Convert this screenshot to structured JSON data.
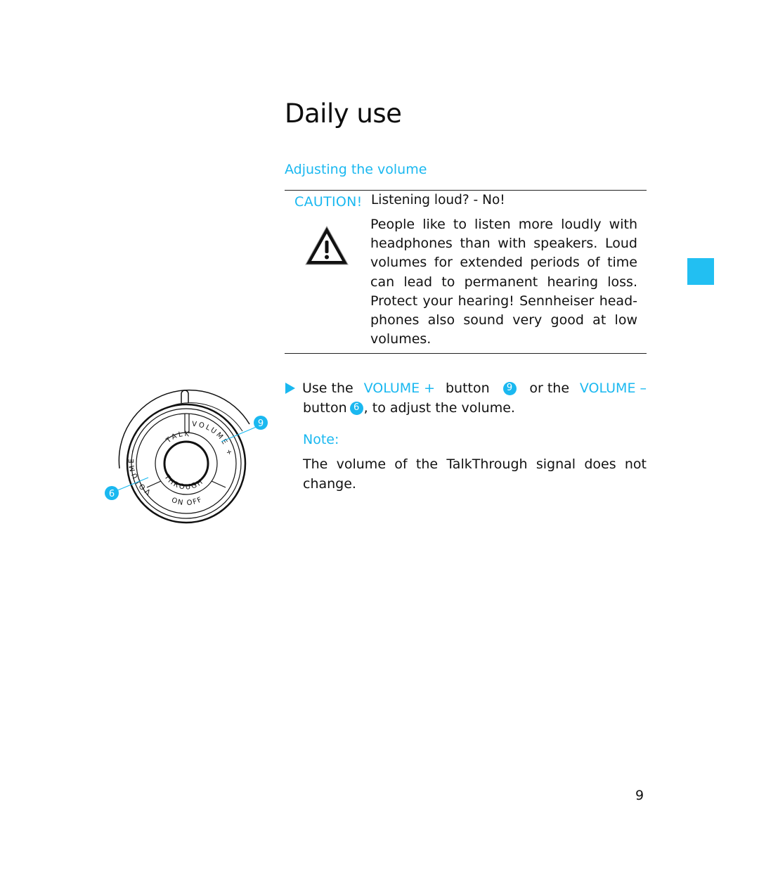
{
  "page": {
    "title": "Daily use",
    "section_heading": "Adjusting the volume",
    "page_number": "9",
    "accent_color": "#1ab8f0"
  },
  "caution": {
    "label": "CAUTION!",
    "heading": "Listening loud? - No!",
    "body": "People like to listen more loudly with headphones than with speakers. Loud volumes for extended periods of time can lead to permanent hearing loss. Protect your hearing! Sennheiser head­phones also sound very good at low volumes.",
    "icon": "warning-triangle-icon"
  },
  "instruction": {
    "text_1": "Use the",
    "volume_plus": "VOLUME +",
    "text_2": "button",
    "callout_plus": "9",
    "text_3": "or the",
    "volume_minus": "VOLUME –",
    "text_4": "button",
    "callout_minus": "6",
    "text_5": ", to adjust the volume."
  },
  "note": {
    "label": "Note:",
    "body": "The volume of the TalkThrough signal does not change."
  },
  "diagram": {
    "label_volume_minus": "VOLUME –",
    "label_volume_plus": "VOLUME +",
    "label_talk": "TALK",
    "label_through": "THROUGH",
    "label_onoff": "ON OFF",
    "callout_plus": "9",
    "callout_minus": "6"
  }
}
